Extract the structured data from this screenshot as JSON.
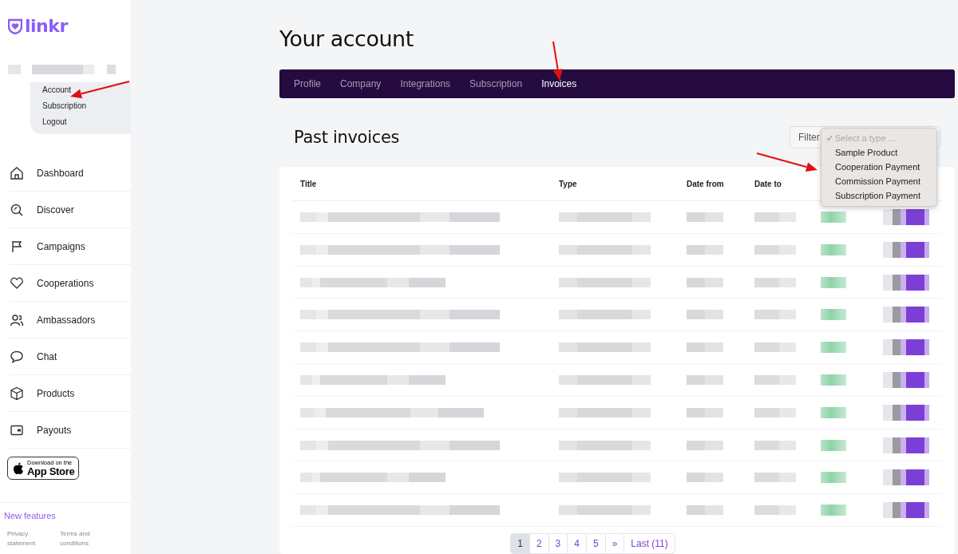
{
  "logo": {
    "text": "linkr"
  },
  "user_menu": {
    "items": [
      {
        "label": "Account"
      },
      {
        "label": "Subscription"
      },
      {
        "label": "Logout"
      }
    ]
  },
  "nav": {
    "items": [
      {
        "label": "Dashboard"
      },
      {
        "label": "Discover"
      },
      {
        "label": "Campaigns"
      },
      {
        "label": "Cooperations"
      },
      {
        "label": "Ambassadors"
      },
      {
        "label": "Chat"
      },
      {
        "label": "Products"
      },
      {
        "label": "Payouts"
      }
    ]
  },
  "app_store": {
    "small": "Download on the",
    "large": "App Store"
  },
  "footer": {
    "new_features": "New features",
    "links": [
      "Privacy statement",
      "Terms and conditions"
    ]
  },
  "page": {
    "title": "Your account"
  },
  "tabs": [
    {
      "label": "Profile",
      "selected": false
    },
    {
      "label": "Company",
      "selected": false
    },
    {
      "label": "Integrations",
      "selected": false
    },
    {
      "label": "Subscription",
      "selected": false
    },
    {
      "label": "Invoices",
      "selected": true
    }
  ],
  "section": {
    "title": "Past invoices"
  },
  "filter": {
    "label": "Filter",
    "options": [
      {
        "label": "Select a type ...",
        "selected": true,
        "kind": "placeholder"
      },
      {
        "label": "Sample Product",
        "selected": false,
        "kind": "option"
      },
      {
        "label": "Cooperation Payment",
        "selected": false,
        "kind": "option"
      },
      {
        "label": "Commission Payment",
        "selected": false,
        "kind": "option"
      },
      {
        "label": "Subscription Payment",
        "selected": false,
        "kind": "option"
      }
    ]
  },
  "table": {
    "columns": [
      "Title",
      "Type",
      "Date from",
      "Date to"
    ],
    "rows": [
      {
        "kind": "redacted"
      },
      {
        "kind": "redacted"
      },
      {
        "kind": "redacted"
      },
      {
        "kind": "redacted"
      },
      {
        "kind": "redacted"
      },
      {
        "kind": "redacted"
      },
      {
        "kind": "redacted"
      },
      {
        "kind": "redacted"
      },
      {
        "kind": "redacted"
      },
      {
        "kind": "redacted"
      }
    ]
  },
  "pagination": {
    "pages": [
      {
        "label": "1",
        "selected": true
      },
      {
        "label": "2",
        "selected": false
      },
      {
        "label": "3",
        "selected": false
      },
      {
        "label": "4",
        "selected": false
      },
      {
        "label": "5",
        "selected": false
      },
      {
        "label": "»",
        "selected": false
      },
      {
        "label": "Last (11)",
        "selected": false
      }
    ]
  }
}
